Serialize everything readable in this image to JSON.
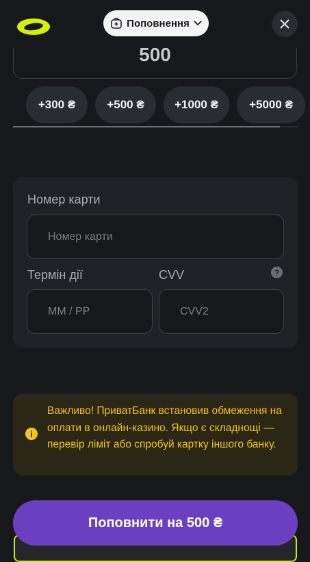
{
  "header": {
    "deposit_label": "Поповнення",
    "accent_color": "#d7f000"
  },
  "amount": {
    "value": "500"
  },
  "presets": [
    "+300 ₴",
    "+500 ₴",
    "+1000 ₴",
    "+5000 ₴"
  ],
  "card_form": {
    "card_number_label": "Номер карти",
    "card_number_placeholder": "Номер карти",
    "expiry_label": "Термін дії",
    "expiry_placeholder": "MM / PP",
    "cvv_label": "CVV",
    "cvv_placeholder": "CVV2",
    "help_symbol": "?"
  },
  "notice": {
    "icon_symbol": "i",
    "text": "Важливо! ПриватБанк встановив обмеження на оплати в онлайн-казино. Якщо є складнощі — перевір ліміт або спробуй картку іншого банку."
  },
  "submit": {
    "label": "Поповнити на 500 ₴",
    "color": "#6a3fc0"
  }
}
